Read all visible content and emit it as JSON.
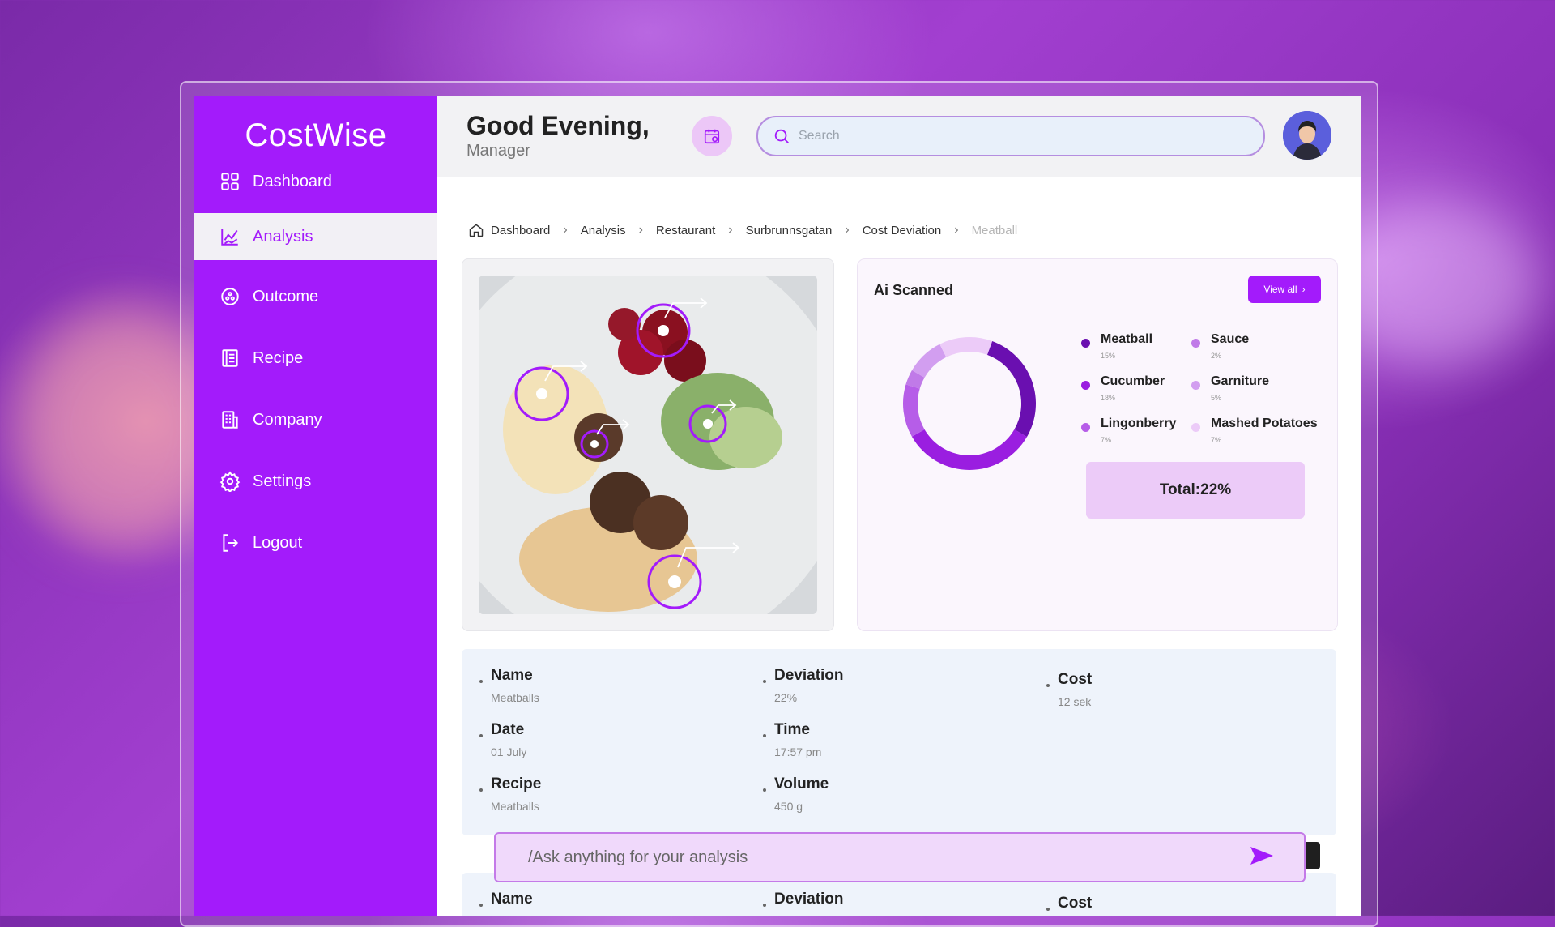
{
  "brand": "CostWise",
  "colors": {
    "primary": "#a31bfb",
    "accent_light": "#eccbf8",
    "panel": "#eef3fb"
  },
  "sidebar": {
    "items": [
      {
        "label": "Dashboard",
        "icon": "grid-icon"
      },
      {
        "label": "Analysis",
        "icon": "chart-icon",
        "active": true
      },
      {
        "label": "Outcome",
        "icon": "outcome-icon"
      },
      {
        "label": "Recipe",
        "icon": "book-icon"
      },
      {
        "label": "Company",
        "icon": "building-icon"
      },
      {
        "label": "Settings",
        "icon": "gear-icon"
      },
      {
        "label": "Logout",
        "icon": "logout-icon"
      }
    ]
  },
  "header": {
    "greeting": "Good Evening,",
    "role": "Manager",
    "search_placeholder": "Search"
  },
  "breadcrumb": [
    "Dashboard",
    "Analysis",
    "Restaurant",
    "Surbrunnsgatan",
    "Cost Deviation",
    "Meatball"
  ],
  "ai_panel": {
    "title": "Ai Scanned",
    "view_all": "View all",
    "total": "Total:22%"
  },
  "chart_data": {
    "type": "pie",
    "series": [
      {
        "name": "Meatball",
        "value": 15,
        "label": "15%",
        "color": "#6a0fb0"
      },
      {
        "name": "Cucumber",
        "value": 18,
        "label": "18%",
        "color": "#9a1ee0"
      },
      {
        "name": "Lingonberry",
        "value": 7,
        "label": "7%",
        "color": "#b65de8"
      },
      {
        "name": "Sauce",
        "value": 2,
        "label": "2%",
        "color": "#c07ae8"
      },
      {
        "name": "Garniture",
        "value": 5,
        "label": "5%",
        "color": "#d29ef0"
      },
      {
        "name": "Mashed Potatoes",
        "value": 7,
        "label": "7%",
        "color": "#eccbf8"
      }
    ]
  },
  "details": {
    "name_label": "Name",
    "name_value": "Meatballs",
    "deviation_label": "Deviation",
    "deviation_value": "22%",
    "cost_label": "Cost",
    "cost_value": "12 sek",
    "date_label": "Date",
    "date_value": "01 July",
    "time_label": "Time",
    "time_value": "17:57 pm",
    "recipe_label": "Recipe",
    "recipe_value": "Meatballs",
    "volume_label": "Volume",
    "volume_value": "450 g"
  },
  "details2": {
    "name_label": "Name",
    "deviation_label": "Deviation",
    "cost_label": "Cost"
  },
  "ask": {
    "placeholder": "/Ask anything for your analysis"
  }
}
